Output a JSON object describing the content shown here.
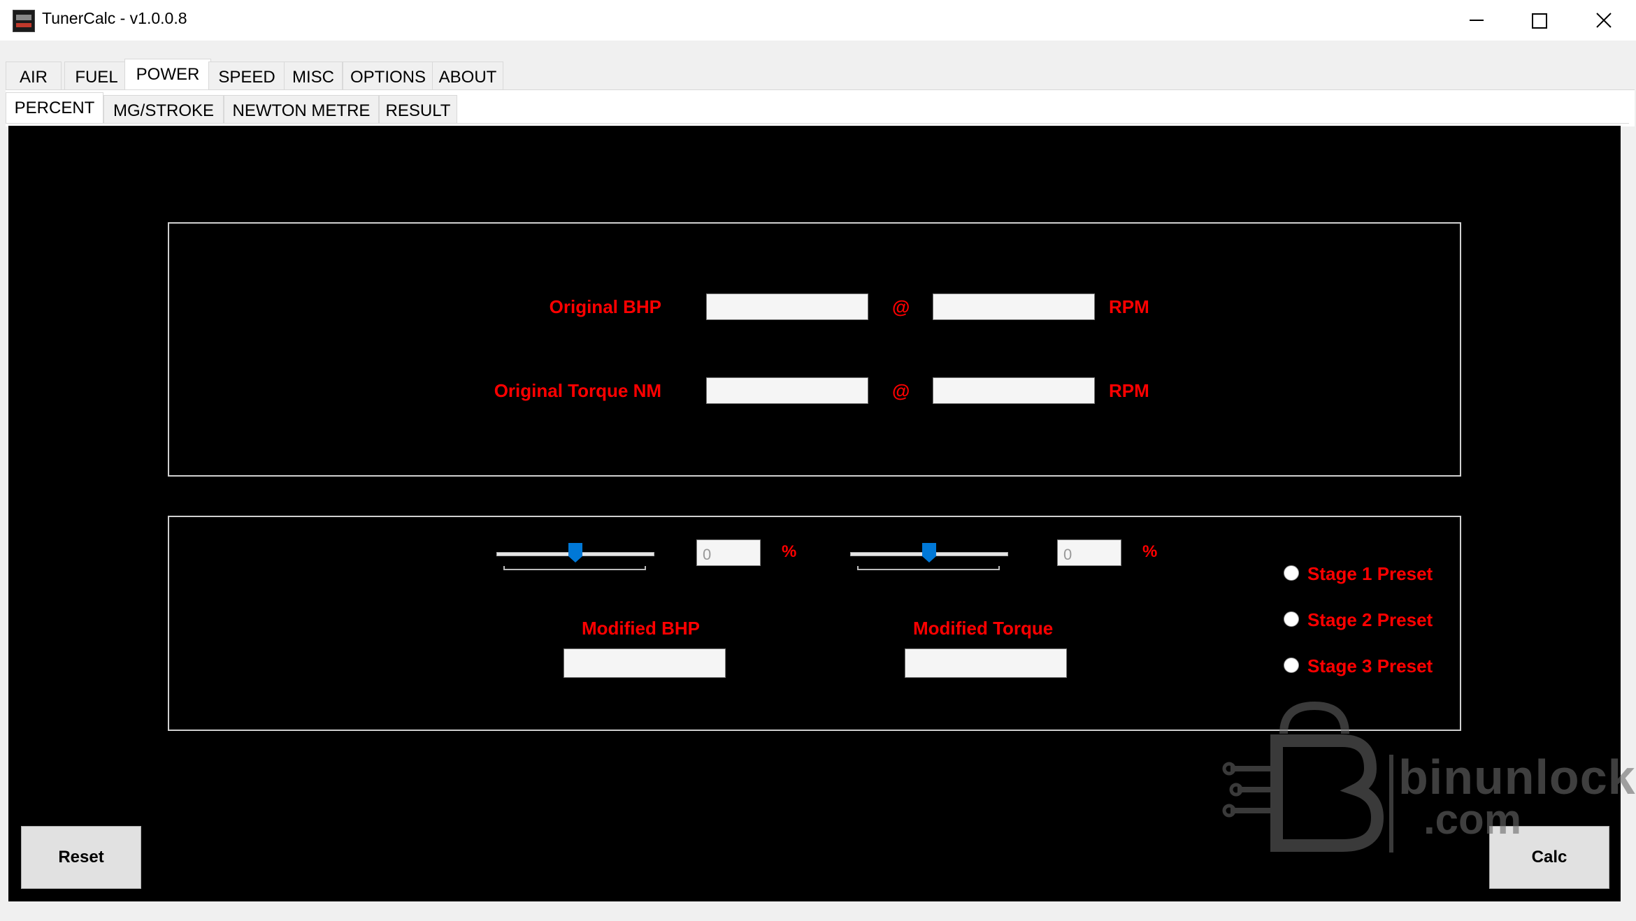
{
  "window": {
    "title": "TunerCalc - v1.0.0.8"
  },
  "main_tabs": [
    "AIR",
    "FUEL",
    "POWER",
    "SPEED",
    "MISC",
    "OPTIONS",
    "ABOUT"
  ],
  "main_tabs_active": "POWER",
  "sub_tabs": [
    "PERCENT",
    "MG/STROKE",
    "NEWTON METRE",
    "RESULT"
  ],
  "sub_tabs_active": "PERCENT",
  "original": {
    "bhp_label": "Original BHP",
    "torque_label": "Original Torque NM",
    "at_symbol": "@",
    "rpm_label": "RPM",
    "bhp_value": "",
    "bhp_rpm_value": "",
    "torque_value": "",
    "torque_rpm_value": ""
  },
  "modified": {
    "bhp_percent": "0",
    "torque_percent": "0",
    "percent_symbol": "%",
    "bhp_label": "Modified BHP",
    "torque_label": "Modified Torque",
    "bhp_value": "",
    "torque_value": "",
    "bhp_slider_level": 0.5,
    "torque_slider_level": 0.5
  },
  "presets": [
    "Stage 1 Preset",
    "Stage 2 Preset",
    "Stage 3 Preset"
  ],
  "buttons": {
    "reset": "Reset",
    "calc": "Calc"
  },
  "watermark": {
    "line1": "binunlock",
    "line2": ".com"
  },
  "colors": {
    "label_red": "#ff0000",
    "slider_thumb": "#0078d7",
    "panel_bg": "#000000"
  }
}
